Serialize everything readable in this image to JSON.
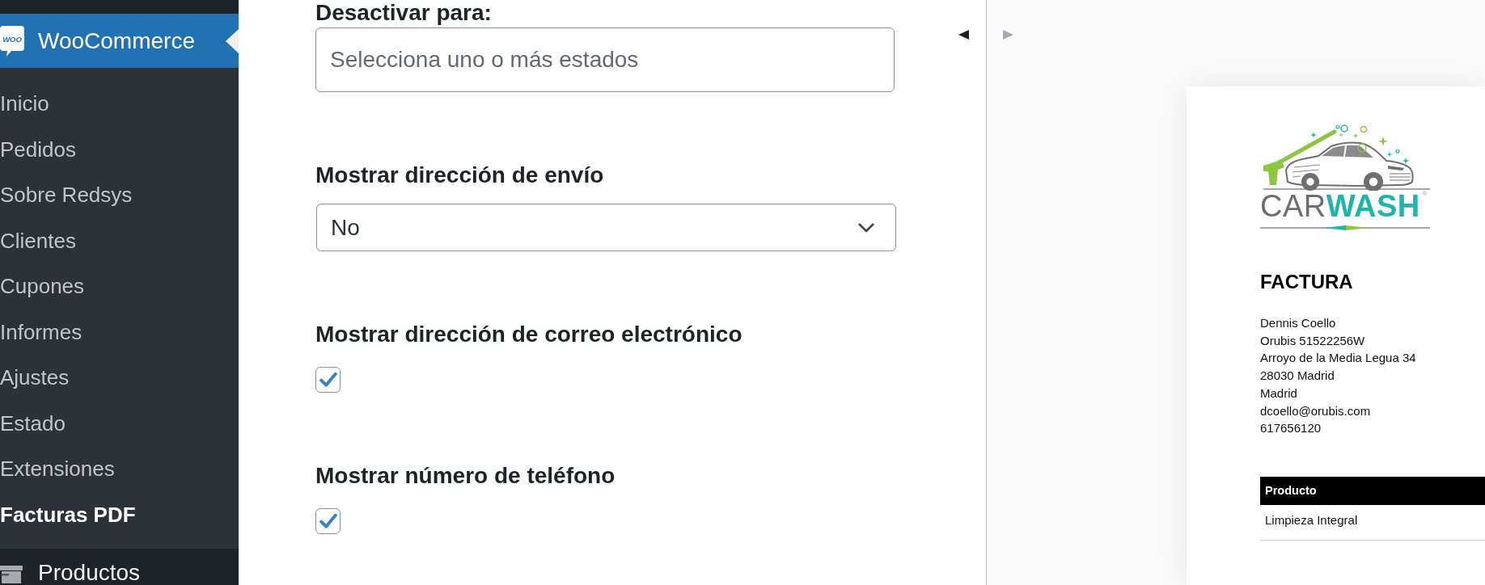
{
  "sidebar": {
    "menu": [
      {
        "label": "WooCommerce",
        "logo_text": "WOO",
        "selected": true,
        "children": [
          {
            "label": "Inicio",
            "selected": false
          },
          {
            "label": "Pedidos",
            "selected": false
          },
          {
            "label": "Sobre Redsys",
            "selected": false
          },
          {
            "label": "Clientes",
            "selected": false
          },
          {
            "label": "Cupones",
            "selected": false
          },
          {
            "label": "Informes",
            "selected": false
          },
          {
            "label": "Ajustes",
            "selected": false
          },
          {
            "label": "Estado",
            "selected": false
          },
          {
            "label": "Extensiones",
            "selected": false
          },
          {
            "label": "Facturas PDF",
            "selected": true
          }
        ]
      },
      {
        "label": "Productos",
        "selected": false
      }
    ]
  },
  "settings": [
    {
      "kind": "multiselect",
      "label": "Desactivar para:",
      "placeholder": "Selecciona uno o más estados"
    },
    {
      "kind": "select",
      "label": "Mostrar dirección de envío",
      "value": "No"
    },
    {
      "kind": "checkbox",
      "label": "Mostrar dirección de correo electrónico",
      "checked": true
    },
    {
      "kind": "checkbox",
      "label": "Mostrar número de teléfono",
      "checked": true
    }
  ],
  "panel_arrows": [
    {
      "kind": "left",
      "disabled": false
    },
    {
      "kind": "right",
      "disabled": true
    }
  ],
  "invoice": {
    "logo": {
      "word_1": "CAR",
      "word_2": "WASH",
      "mark": "®"
    },
    "title": "FACTURA",
    "customer_lines": [
      "Dennis Coello",
      "Orubis 51522256W",
      "Arroyo de la Media Legua 34",
      "28030 Madrid",
      "Madrid",
      "dcoello@orubis.com",
      "617656120"
    ],
    "table": {
      "columns": [
        "Producto"
      ],
      "rows": [
        [
          "Limpieza Integral"
        ]
      ]
    }
  }
}
